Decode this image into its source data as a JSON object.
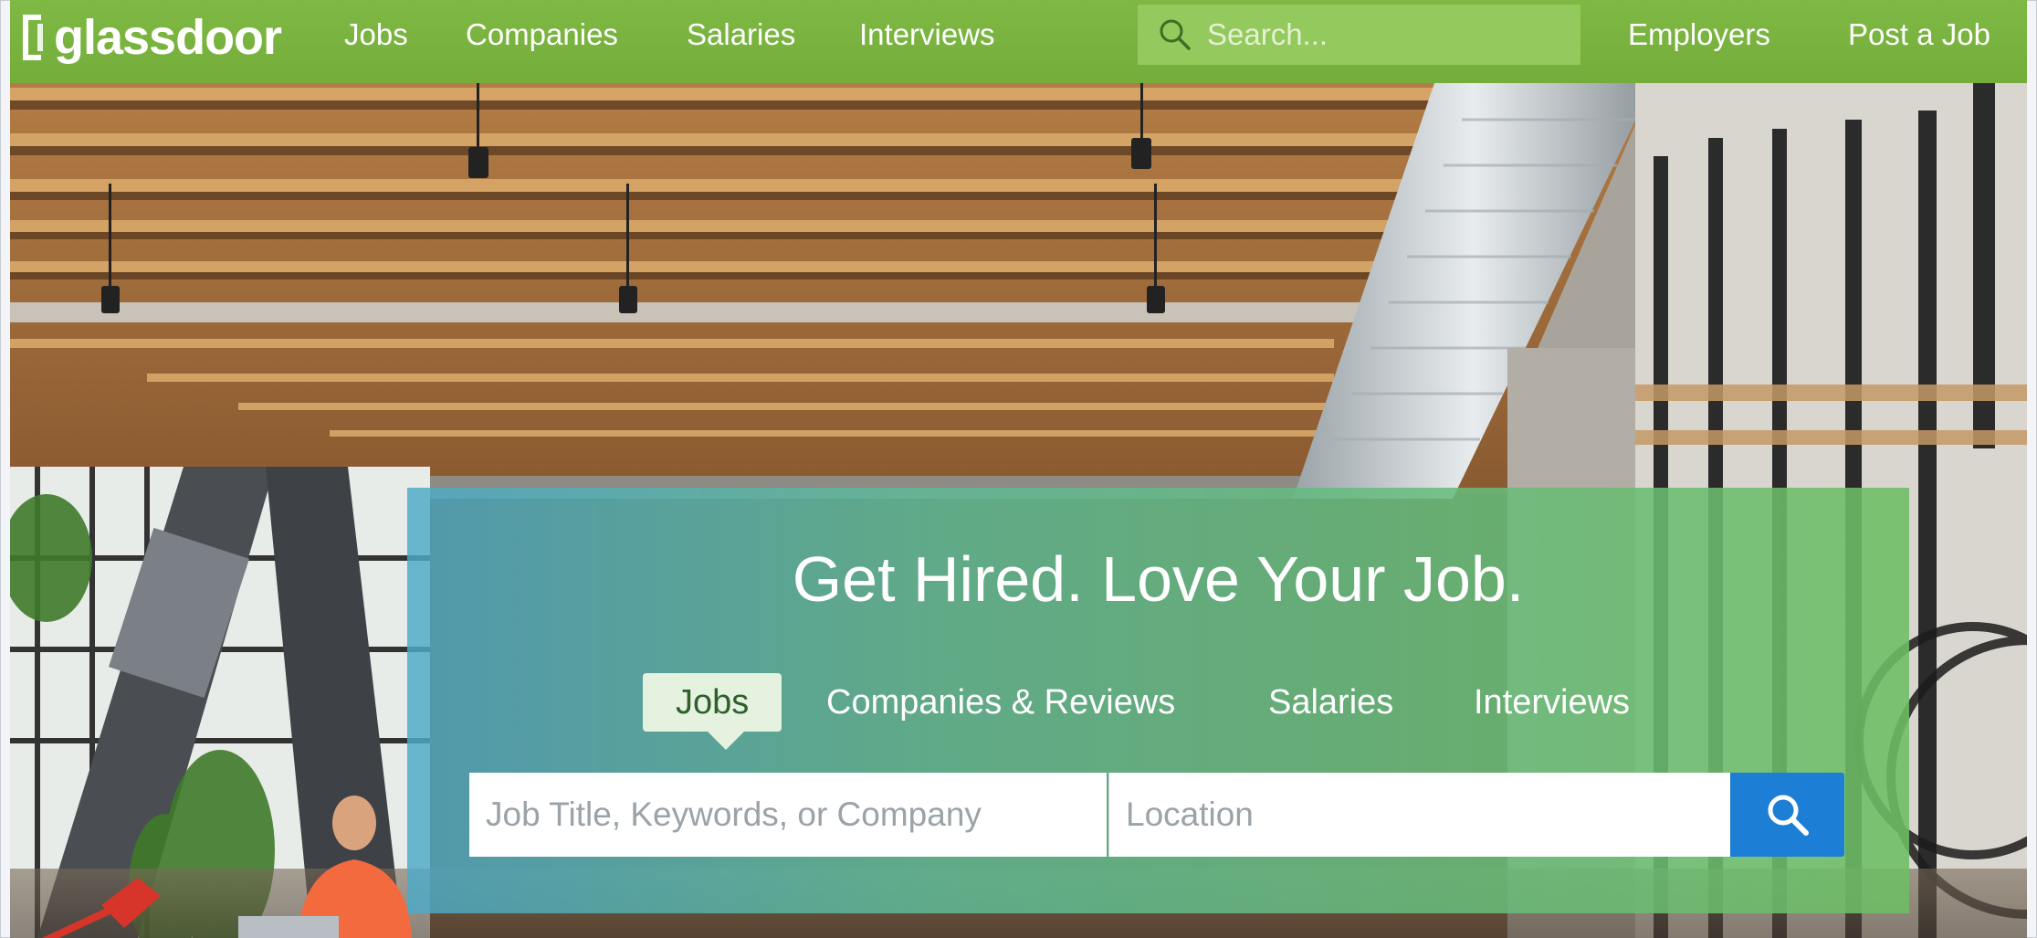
{
  "brand": {
    "name": "glassdoor",
    "primary_color": "#7cb540",
    "cta_color": "#1d7ed6"
  },
  "topnav": {
    "links": [
      "Jobs",
      "Companies",
      "Salaries",
      "Interviews"
    ],
    "search_placeholder": "Search...",
    "right_links": [
      "Employers",
      "Post a Job"
    ]
  },
  "hero": {
    "headline": "Get Hired. Love Your Job.",
    "tabs": [
      {
        "label": "Jobs",
        "active": true
      },
      {
        "label": "Companies & Reviews",
        "active": false
      },
      {
        "label": "Salaries",
        "active": false
      },
      {
        "label": "Interviews",
        "active": false
      }
    ],
    "job_placeholder": "Job Title, Keywords, or Company",
    "location_placeholder": "Location",
    "submit_icon": "search-icon"
  }
}
